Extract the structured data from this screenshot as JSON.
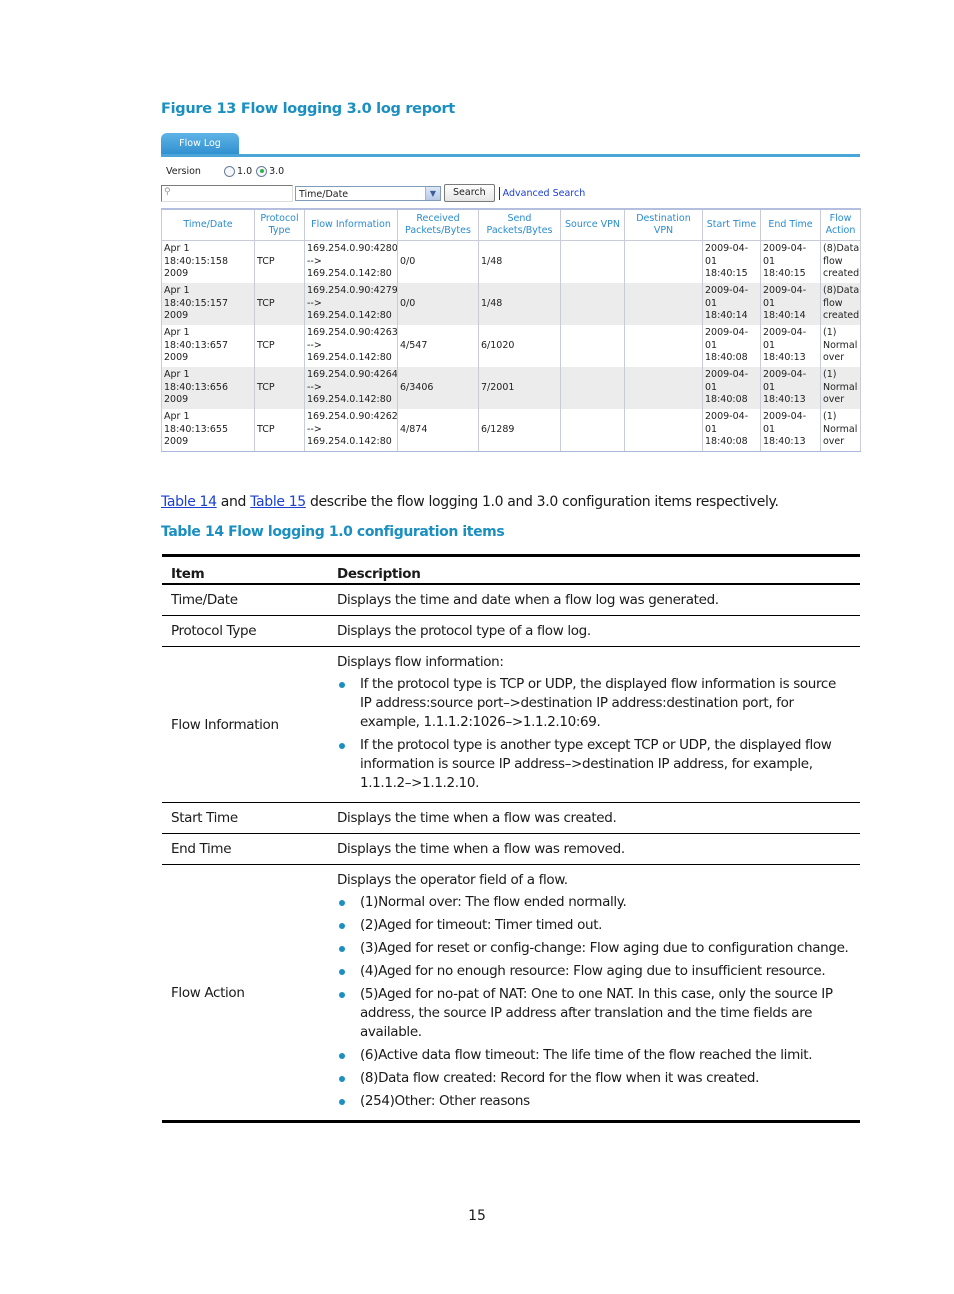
{
  "figure_title": "Figure 13 Flow logging 3.0 log report",
  "screenshot": {
    "tab_label": "Flow Log",
    "version_label": "Version",
    "version_options": [
      {
        "label": "1.0",
        "selected": false
      },
      {
        "label": "3.0",
        "selected": true
      }
    ],
    "search_placeholder": "",
    "search_field_select": "Time/Date",
    "search_button": "Search",
    "advanced_search_link": "Advanced Search",
    "columns": [
      "Time/Date",
      "Protocol Type",
      "Flow Information",
      "Received Packets/Bytes",
      "Send Packets/Bytes",
      "Source VPN",
      "Destination VPN",
      "Start Time",
      "End Time",
      "Flow Action"
    ],
    "rows": [
      {
        "time": "Apr 1 18:40:15:158 2009",
        "protocol": "TCP",
        "flow_src": "169.254.0.90:4280",
        "flow_arrow": "-->",
        "flow_dst": "169.254.0.142:80",
        "received": "0/0",
        "send": "1/48",
        "src_vpn": "",
        "dst_vpn": "",
        "start_date": "2009-04-",
        "start_day": "01",
        "start_time": "18:40:15",
        "end_date": "2009-04-",
        "end_day": "01",
        "end_time": "18:40:15",
        "action1": "(8)Data",
        "action2": "flow",
        "action3": "created"
      },
      {
        "time": "Apr 1 18:40:15:157 2009",
        "protocol": "TCP",
        "flow_src": "169.254.0.90:4279",
        "flow_arrow": "-->",
        "flow_dst": "169.254.0.142:80",
        "received": "0/0",
        "send": "1/48",
        "src_vpn": "",
        "dst_vpn": "",
        "start_date": "2009-04-",
        "start_day": "01",
        "start_time": "18:40:14",
        "end_date": "2009-04-",
        "end_day": "01",
        "end_time": "18:40:14",
        "action1": "(8)Data",
        "action2": "flow",
        "action3": "created"
      },
      {
        "time": "Apr 1 18:40:13:657 2009",
        "protocol": "TCP",
        "flow_src": "169.254.0.90:4263",
        "flow_arrow": "-->",
        "flow_dst": "169.254.0.142:80",
        "received": "4/547",
        "send": "6/1020",
        "src_vpn": "",
        "dst_vpn": "",
        "start_date": "2009-04-",
        "start_day": "01",
        "start_time": "18:40:08",
        "end_date": "2009-04-",
        "end_day": "01",
        "end_time": "18:40:13",
        "action1": "(1)",
        "action2": "Normal",
        "action3": "over"
      },
      {
        "time": "Apr 1 18:40:13:656 2009",
        "protocol": "TCP",
        "flow_src": "169.254.0.90:4264",
        "flow_arrow": "-->",
        "flow_dst": "169.254.0.142:80",
        "received": "6/3406",
        "send": "7/2001",
        "src_vpn": "",
        "dst_vpn": "",
        "start_date": "2009-04-",
        "start_day": "01",
        "start_time": "18:40:08",
        "end_date": "2009-04-",
        "end_day": "01",
        "end_time": "18:40:13",
        "action1": "(1)",
        "action2": "Normal",
        "action3": "over"
      },
      {
        "time": "Apr 1 18:40:13:655 2009",
        "protocol": "TCP",
        "flow_src": "169.254.0.90:4262",
        "flow_arrow": "-->",
        "flow_dst": "169.254.0.142:80",
        "received": "4/874",
        "send": "6/1289",
        "src_vpn": "",
        "dst_vpn": "",
        "start_date": "2009-04-",
        "start_day": "01",
        "start_time": "18:40:08",
        "end_date": "2009-04-",
        "end_day": "01",
        "end_time": "18:40:13",
        "action1": "(1)",
        "action2": "Normal",
        "action3": "over"
      }
    ]
  },
  "paragraph": {
    "link1": "Table 14",
    "mid": " and ",
    "link2": "Table 15",
    "rest": " describe the flow logging 1.0 and 3.0 configuration items respectively."
  },
  "table_title": "Table 14 Flow logging 1.0 configuration items",
  "config_table": {
    "headers": [
      "Item",
      "Description"
    ],
    "time_date": {
      "item": "Time/Date",
      "desc": "Displays the time and date when a flow log was generated."
    },
    "protocol_type": {
      "item": "Protocol Type",
      "desc": "Displays the protocol type of a flow log."
    },
    "flow_information": {
      "item": "Flow Information",
      "intro": "Displays flow information:",
      "bullets": [
        "If the protocol type is TCP or UDP, the displayed flow information is source IP address:source port–>destination IP address:destination port, for example, 1.1.1.2:1026–>1.1.2.10:69.",
        "If the protocol type is another type except TCP or UDP, the displayed flow information is source IP address–>destination IP address, for example, 1.1.1.2–>1.1.2.10."
      ]
    },
    "start_time": {
      "item": "Start Time",
      "desc": "Displays the time when a flow was created."
    },
    "end_time": {
      "item": "End Time",
      "desc": "Displays the time when a flow was removed."
    },
    "flow_action": {
      "item": "Flow Action",
      "intro": "Displays the operator field of a flow.",
      "bullets": [
        "(1)Normal over: The flow ended normally.",
        "(2)Aged for timeout: Timer timed out.",
        "(3)Aged for reset or config-change: Flow aging due to configuration change.",
        "(4)Aged for no enough resource: Flow aging due to insufficient resource.",
        "(5)Aged for no-pat of NAT: One to one NAT. In this case, only the source IP address, the source IP address after translation and the time fields are available.",
        "(6)Active data flow timeout: The life time of the flow reached the limit.",
        "(8)Data flow created: Record for the flow when it was created.",
        "(254)Other: Other reasons"
      ]
    }
  },
  "page_number": "15"
}
